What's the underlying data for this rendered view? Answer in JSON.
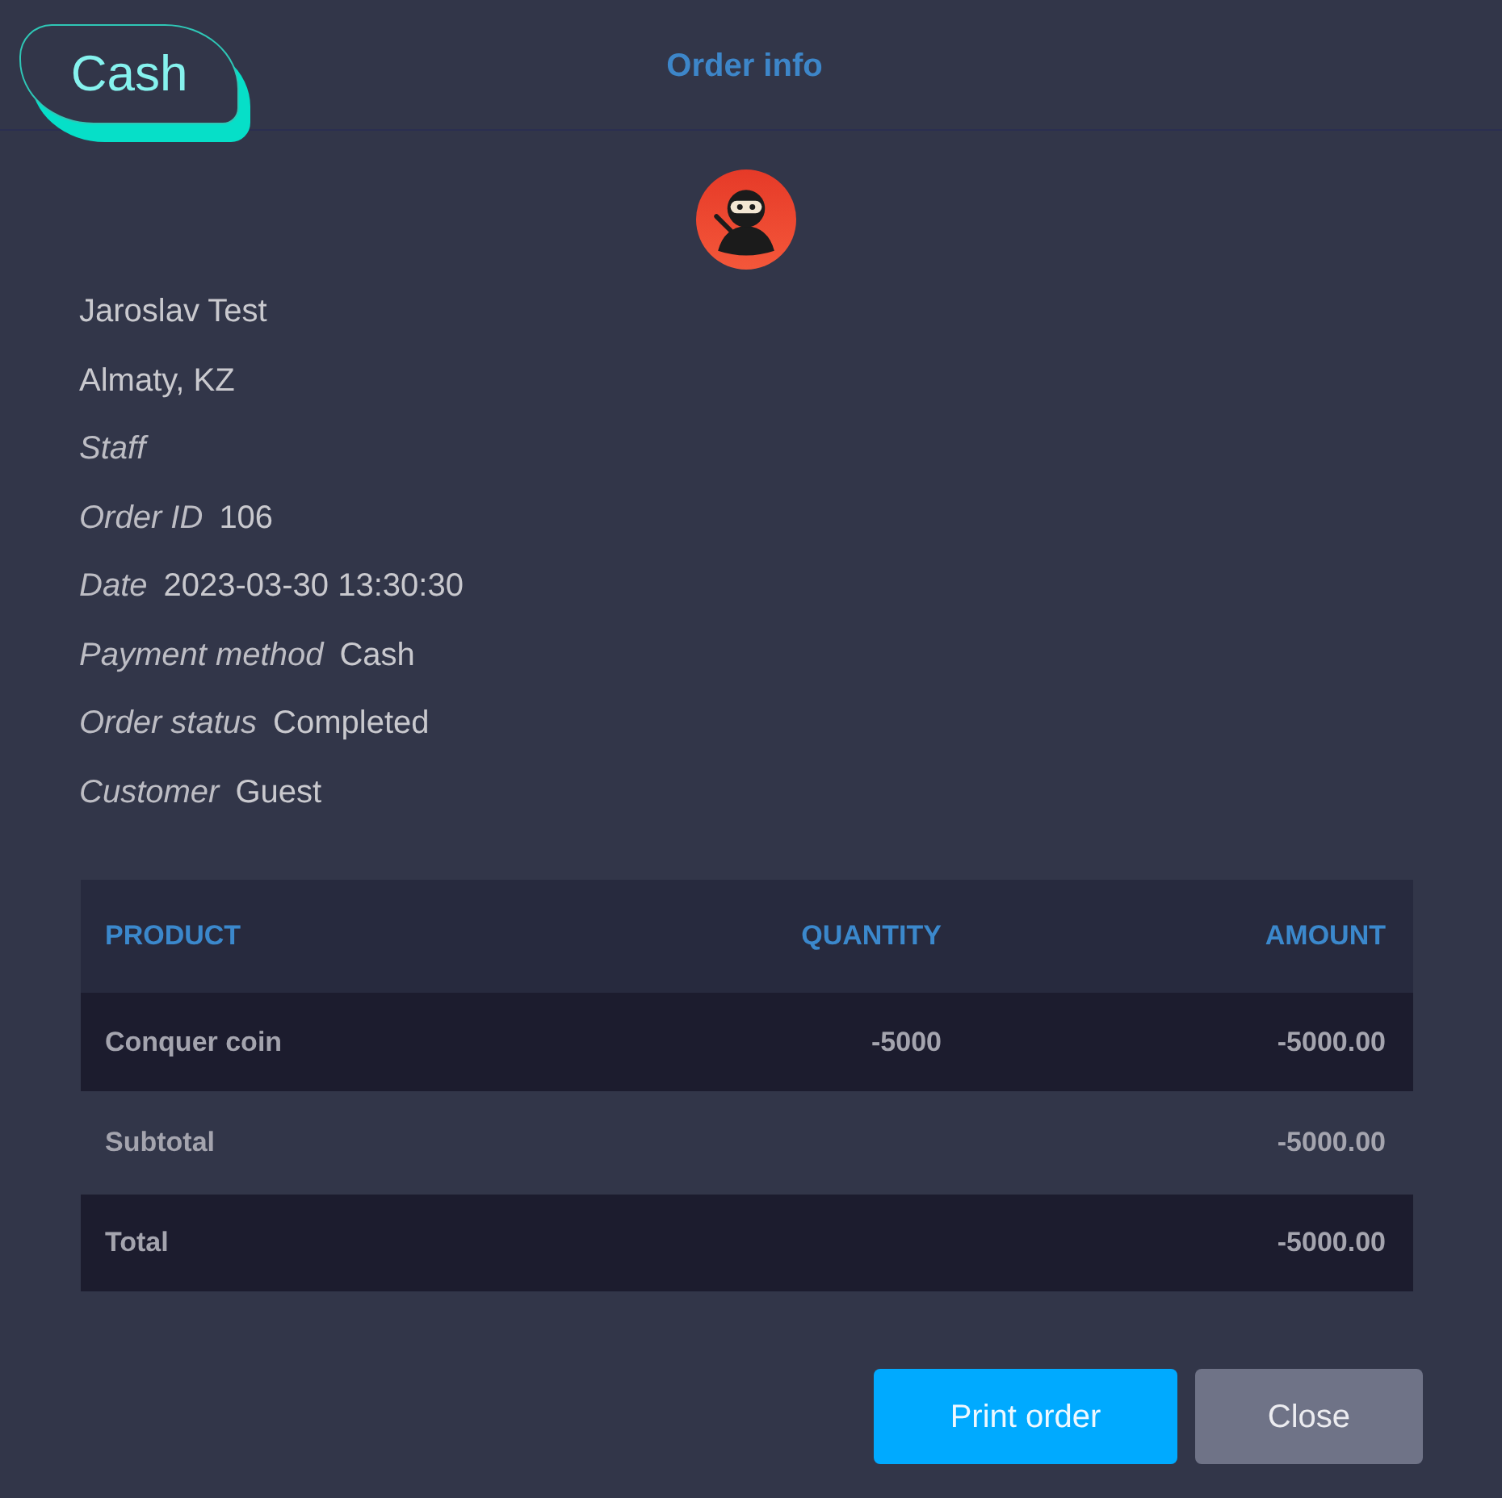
{
  "badge": {
    "label": "Cash"
  },
  "title": "Order info",
  "customer": {
    "name": "Jaroslav Test",
    "location": "Almaty, KZ"
  },
  "details": [
    {
      "label": "Staff"
    },
    {
      "label": "Order ID",
      "value": "106"
    },
    {
      "label": "Date",
      "value": "2023-03-30 13:30:30"
    },
    {
      "label": "Payment method",
      "value": "Cash"
    },
    {
      "label": "Order status",
      "value": "Completed"
    },
    {
      "label": "Customer",
      "value": "Guest"
    }
  ],
  "table": {
    "columns": [
      "PRODUCT",
      "QUANTITY",
      "AMOUNT"
    ],
    "rows": [
      {
        "kind": "item",
        "product": "Conquer coin",
        "quantity": "-5000",
        "amount": "-5000.00"
      },
      {
        "kind": "subtotal",
        "label": "Subtotal",
        "amount": "-5000.00"
      },
      {
        "kind": "total",
        "label": "Total",
        "amount": "-5000.00"
      }
    ]
  },
  "buttons": [
    {
      "kind": "primary",
      "label": "Print order"
    },
    {
      "kind": "secondary",
      "label": "Close"
    }
  ]
}
